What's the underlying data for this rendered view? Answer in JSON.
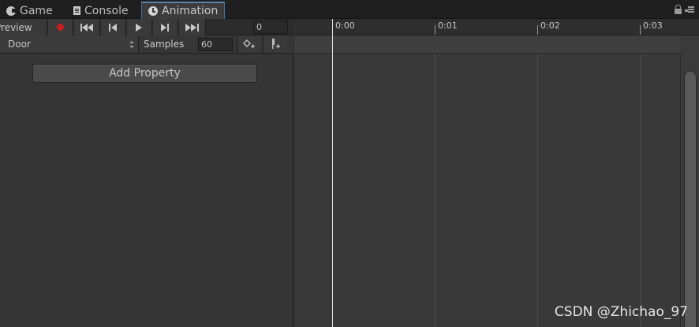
{
  "tabs": [
    {
      "label": "Game",
      "icon": "game-controller-icon"
    },
    {
      "label": "Console",
      "icon": "console-icon"
    },
    {
      "label": "Animation",
      "icon": "clock-icon",
      "active": true
    }
  ],
  "toolbar": {
    "preview_label": "Preview",
    "frame_value": "0",
    "clip_name": "Door",
    "samples_label": "Samples",
    "samples_value": "60",
    "record_color": "#c8201e"
  },
  "properties": {
    "add_property_label": "Add Property"
  },
  "timeline": {
    "ticks": [
      "0:00",
      "0:01",
      "0:02",
      "0:03"
    ]
  },
  "watermark": "CSDN @Zhichao_97"
}
